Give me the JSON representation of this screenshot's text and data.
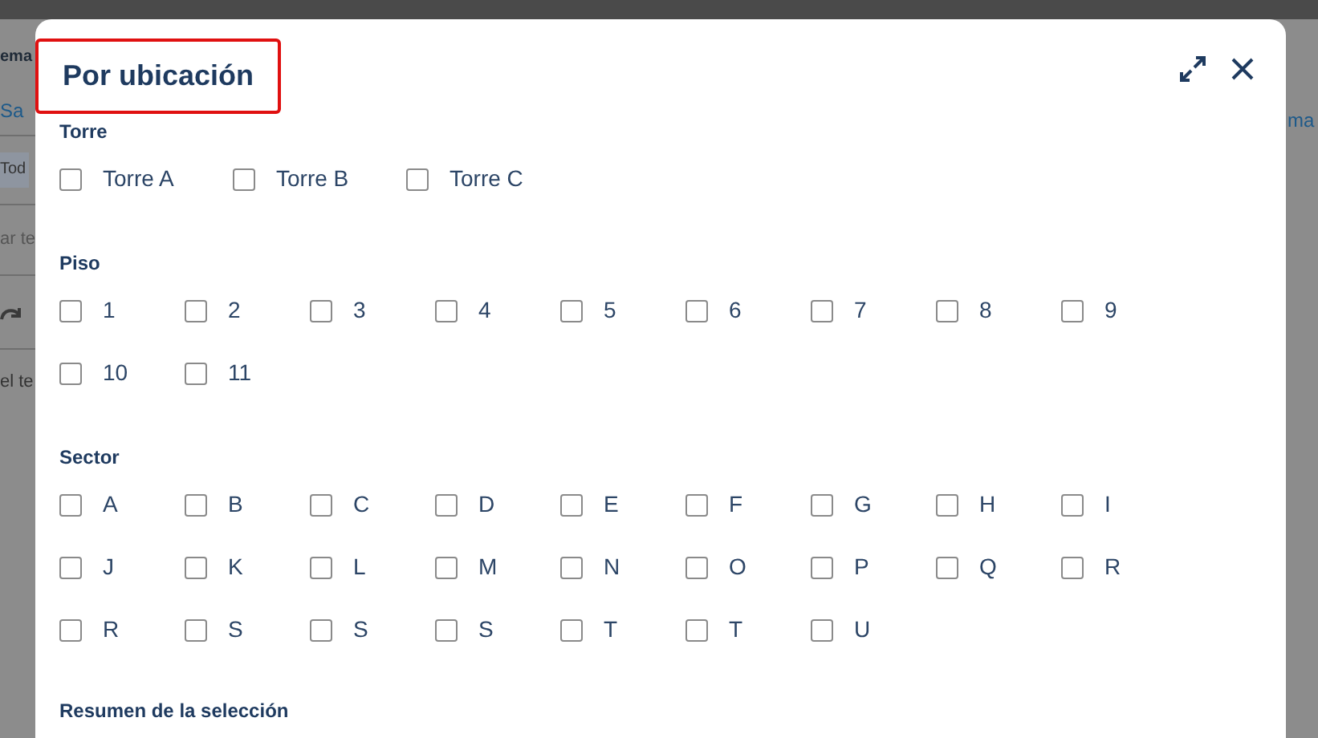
{
  "background": {
    "left_fragments": [
      {
        "kind": "heading",
        "text": "ema"
      },
      {
        "kind": "link",
        "text": "Sa"
      },
      {
        "kind": "chip",
        "text": "Tod"
      },
      {
        "kind": "placeholder",
        "text": "ar te"
      },
      {
        "kind": "redo"
      },
      {
        "kind": "text",
        "text": "el te"
      }
    ],
    "right_fragments": [
      {
        "kind": "link",
        "text": "ma"
      }
    ]
  },
  "dialog": {
    "title": "Por ubicación",
    "title_highlighted": true,
    "sections": [
      {
        "label": "Torre",
        "options": [
          {
            "label": "Torre A",
            "checked": false
          },
          {
            "label": "Torre B",
            "checked": false
          },
          {
            "label": "Torre C",
            "checked": false
          }
        ]
      },
      {
        "label": "Piso",
        "options": [
          {
            "label": "1",
            "checked": false
          },
          {
            "label": "2",
            "checked": false
          },
          {
            "label": "3",
            "checked": false
          },
          {
            "label": "4",
            "checked": false
          },
          {
            "label": "5",
            "checked": false
          },
          {
            "label": "6",
            "checked": false
          },
          {
            "label": "7",
            "checked": false
          },
          {
            "label": "8",
            "checked": false
          },
          {
            "label": "9",
            "checked": false
          },
          {
            "label": "10",
            "checked": false
          },
          {
            "label": "11",
            "checked": false
          }
        ]
      },
      {
        "label": "Sector",
        "options": [
          {
            "label": "A",
            "checked": false
          },
          {
            "label": "B",
            "checked": false
          },
          {
            "label": "C",
            "checked": false
          },
          {
            "label": "D",
            "checked": false
          },
          {
            "label": "E",
            "checked": false
          },
          {
            "label": "F",
            "checked": false
          },
          {
            "label": "G",
            "checked": false
          },
          {
            "label": "H",
            "checked": false
          },
          {
            "label": "I",
            "checked": false
          },
          {
            "label": "J",
            "checked": false
          },
          {
            "label": "K",
            "checked": false
          },
          {
            "label": "L",
            "checked": false
          },
          {
            "label": "M",
            "checked": false
          },
          {
            "label": "N",
            "checked": false
          },
          {
            "label": "O",
            "checked": false
          },
          {
            "label": "P",
            "checked": false
          },
          {
            "label": "Q",
            "checked": false
          },
          {
            "label": "R",
            "checked": false
          },
          {
            "label": "R",
            "checked": false
          },
          {
            "label": "S",
            "checked": false
          },
          {
            "label": "S",
            "checked": false
          },
          {
            "label": "S",
            "checked": false
          },
          {
            "label": "T",
            "checked": false
          },
          {
            "label": "T",
            "checked": false
          },
          {
            "label": "U",
            "checked": false
          }
        ]
      }
    ],
    "summary_label": "Resumen de la selección"
  }
}
